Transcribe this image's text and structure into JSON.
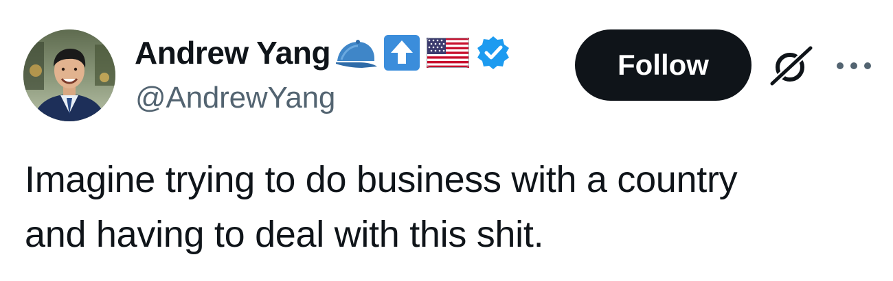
{
  "author": {
    "display_name": "Andrew Yang",
    "handle": "@AndrewYang",
    "avatar_icon": "andrew-yang-avatar",
    "badges": [
      "blue-cap-icon",
      "up-arrow-icon",
      "us-flag-icon",
      "verified-badge-icon"
    ],
    "verified_color": "#1d9bf0"
  },
  "actions": {
    "follow_label": "Follow",
    "grok_icon": "grok-icon",
    "more_icon": "more-options-icon"
  },
  "tweet": {
    "lines": [
      "Imagine trying to do business with a country",
      "and having to deal with this shit."
    ]
  },
  "colors": {
    "text": "#0f1419",
    "secondary_text": "#536471",
    "follow_bg": "#0f1419",
    "follow_text": "#ffffff",
    "verified": "#1d9bf0"
  }
}
